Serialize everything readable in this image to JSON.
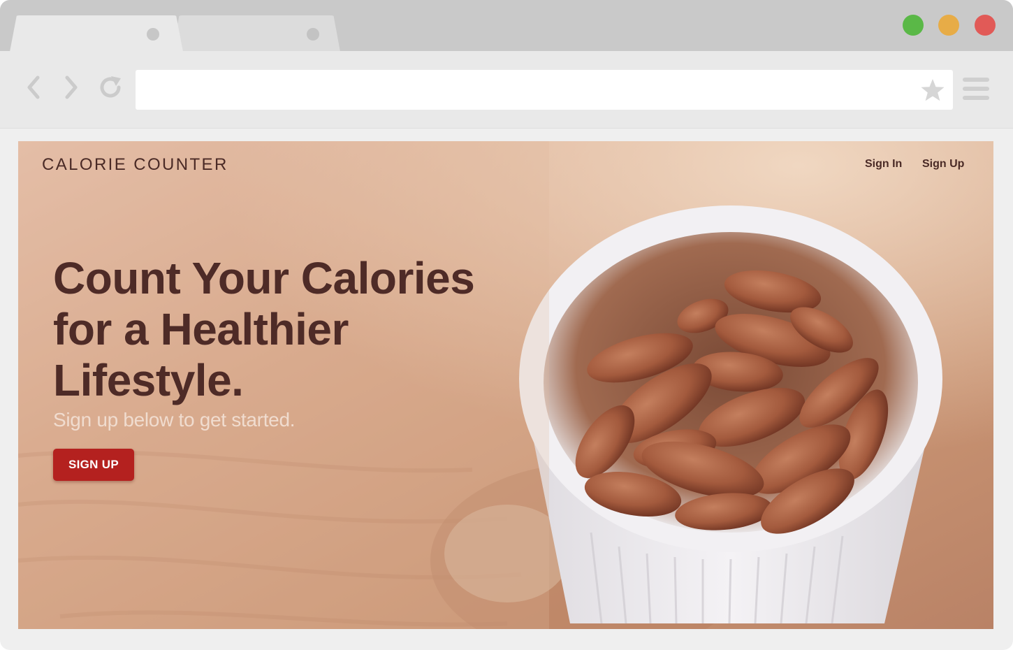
{
  "browser": {
    "tabs": [
      {
        "label": "",
        "active": true
      },
      {
        "label": "",
        "active": false
      }
    ],
    "window_controls": [
      {
        "name": "maximize",
        "color": "#5ab847"
      },
      {
        "name": "minimize",
        "color": "#e7ac47"
      },
      {
        "name": "close",
        "color": "#e15a57"
      }
    ],
    "toolbar": {
      "back_icon": "chevron-left-icon",
      "forward_icon": "chevron-right-icon",
      "reload_icon": "reload-icon",
      "bookmark_icon": "star-icon",
      "menu_icon": "hamburger-menu-icon"
    },
    "address_bar": {
      "value": "",
      "placeholder": ""
    }
  },
  "page": {
    "brand": "CALORIE COUNTER",
    "nav": {
      "sign_in": "Sign In",
      "sign_up": "Sign Up"
    },
    "hero": {
      "headline": "Count Your Calories for a Healthier Lifestyle.",
      "subheadline": "Sign up below to get started.",
      "cta_label": "SIGN UP",
      "background_image": "bowl-of-almonds-photo"
    },
    "colors": {
      "brand_text": "#4a2a26",
      "cta": "#b4211f",
      "subheadline": "#f0dccf"
    }
  }
}
